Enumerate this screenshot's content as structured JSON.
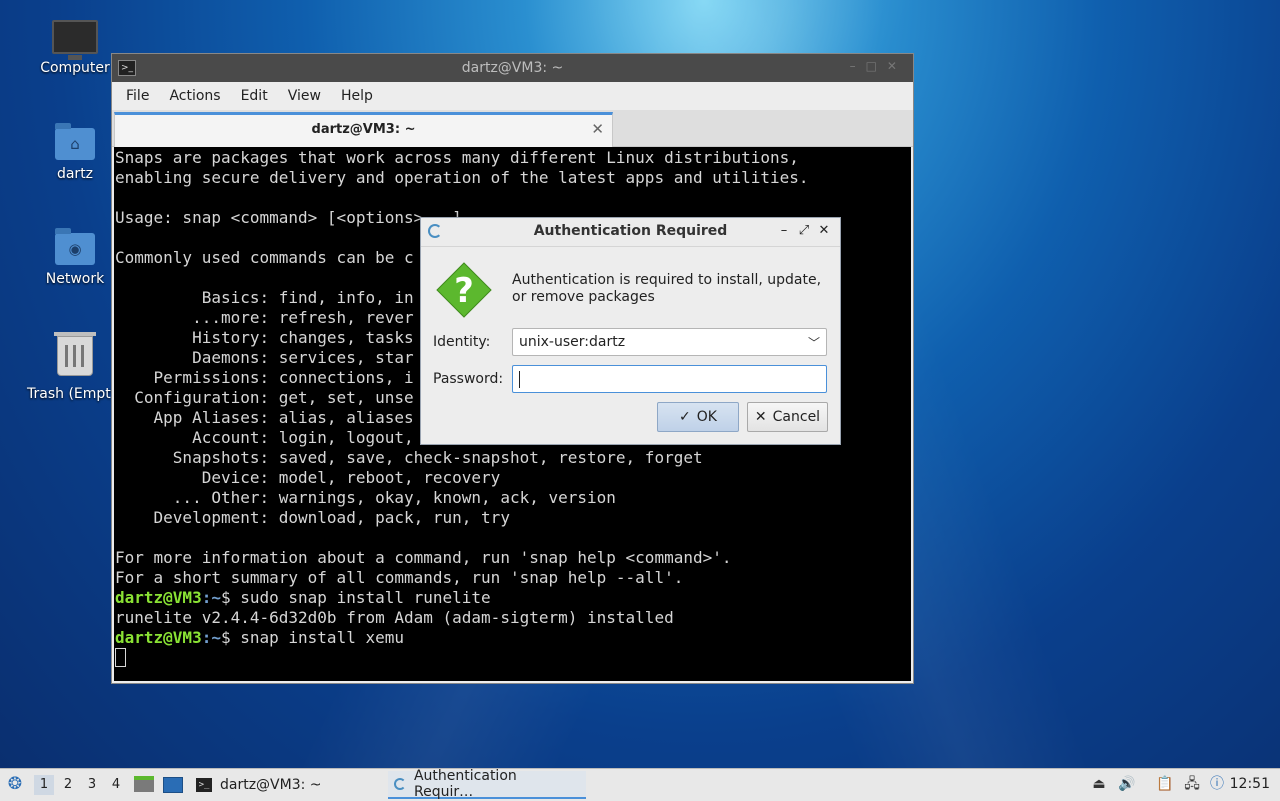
{
  "desktop": {
    "icons": [
      {
        "label": "Computer"
      },
      {
        "label": "dartz"
      },
      {
        "label": "Network"
      },
      {
        "label": "Trash (Empty)"
      }
    ]
  },
  "terminal": {
    "window_title": "dartz@VM3: ~",
    "menu": [
      "File",
      "Actions",
      "Edit",
      "View",
      "Help"
    ],
    "tab_label": "dartz@VM3: ~",
    "lines": [
      "Snaps are packages that work across many different Linux distributions,",
      "enabling secure delivery and operation of the latest apps and utilities.",
      "",
      "Usage: snap <command> [<options>...]",
      "",
      "Commonly used commands can be c",
      "",
      "         Basics: find, info, in",
      "        ...more: refresh, rever",
      "        History: changes, tasks",
      "        Daemons: services, star",
      "    Permissions: connections, i",
      "  Configuration: get, set, unse",
      "    App Aliases: alias, aliases",
      "        Account: login, logout,",
      "      Snapshots: saved, save, check-snapshot, restore, forget",
      "         Device: model, reboot, recovery",
      "      ... Other: warnings, okay, known, ack, version",
      "    Development: download, pack, run, try",
      "",
      "For more information about a command, run 'snap help <command>'.",
      "For a short summary of all commands, run 'snap help --all'."
    ],
    "prompt_user": "dartz@VM3",
    "prompt_path": ":~",
    "prompt_symbol": "$ ",
    "cmd1": "sudo snap install runelite",
    "output1": "runelite v2.4.4-6d32d0b from Adam (adam-sigterm) installed",
    "cmd2": "snap install xemu"
  },
  "auth_dialog": {
    "title": "Authentication Required",
    "message": "Authentication is required to install, update, or remove packages",
    "identity_label": "Identity:",
    "identity_value": "unix-user:dartz",
    "password_label": "Password:",
    "password_value": "",
    "ok_label": "OK",
    "cancel_label": "Cancel",
    "minimize_glyph": "–",
    "maximize_glyph": "⤢",
    "close_glyph": "✕"
  },
  "taskbar": {
    "workspaces": [
      "1",
      "2",
      "3",
      "4"
    ],
    "active_workspace": "1",
    "tasks": [
      {
        "label": "dartz@VM3: ~",
        "icon": "terminal-icon"
      },
      {
        "label": "Authentication Requir…",
        "icon": "polkit-icon",
        "active": true
      }
    ],
    "clock": "12:51"
  },
  "colors": {
    "accent": "#4a90d9",
    "prompt_user": "#8ae234",
    "prompt_path": "#729fcf",
    "question_icon": "#5cb82e"
  }
}
